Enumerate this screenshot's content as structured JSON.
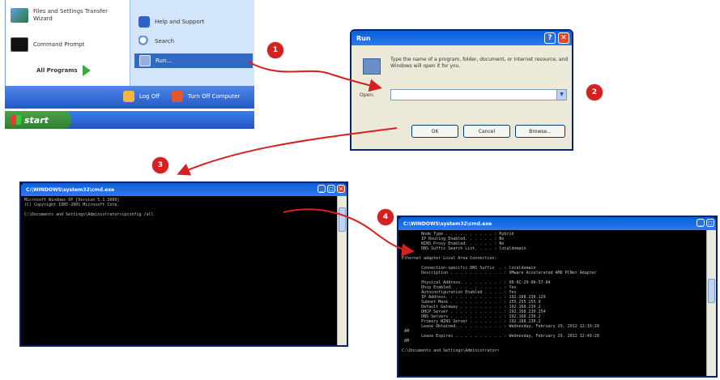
{
  "start_menu": {
    "items_left": [
      {
        "label": "Files and Settings Transfer Wizard",
        "icon": "transfer-wizard-icon"
      },
      {
        "label": "Command Prompt",
        "icon": "command-prompt-icon"
      }
    ],
    "all_programs": "All Programs",
    "items_right": [
      {
        "label": "Help and Support",
        "icon": "help-icon"
      },
      {
        "label": "Search",
        "icon": "search-icon"
      },
      {
        "label": "Run...",
        "icon": "run-icon"
      }
    ],
    "log_off": "Log Off",
    "turn_off": "Turn Off Computer",
    "start_button": "start"
  },
  "run_dialog": {
    "title": "Run",
    "description": "Type the name of a program, folder, document, or Internet resource, and Windows will open it for you.",
    "open_label": "Open:",
    "open_value": "",
    "buttons": {
      "ok": "OK",
      "cancel": "Cancel",
      "browse": "Browse..."
    }
  },
  "console1": {
    "title": "C:\\WINDOWS\\system32\\cmd.exe",
    "lines": [
      "Microsoft Windows XP [Version 5.1.2600]",
      "(C) Copyright 1985-2001 Microsoft Corp.",
      "",
      "C:\\Documents and Settings\\Administrator>ipconfig /all"
    ]
  },
  "console2": {
    "title": "C:\\WINDOWS\\system32\\cmd.exe",
    "lines": [
      "        Node Type . . . . . . . . . . : Hybrid",
      "        IP Routing Enabled. . . . . . : No",
      "        WINS Proxy Enabled. . . . . . : No",
      "        DNS Suffix Search List. . . . : localdomain",
      "",
      "Ethernet adapter Local Area Connection:",
      "",
      "        Connection-specific DNS Suffix  . : localdomain",
      "        Description . . . . . . . . . . . : VMware Accelerated AMD PCNet Adapter",
      "",
      "        Physical Address. . . . . . . . . : 00-0C-29-0A-57-84",
      "        Dhcp Enabled. . . . . . . . . . . : Yes",
      "        Autoconfiguration Enabled . . . . : Yes",
      "        IP Address. . . . . . . . . . . . : 192.168.230.129",
      "        Subnet Mask . . . . . . . . . . . : 255.255.255.0",
      "        Default Gateway . . . . . . . . . : 192.168.230.2",
      "        DHCP Server . . . . . . . . . . . : 192.168.230.254",
      "        DNS Servers . . . . . . . . . . . : 192.168.230.2",
      "        Primary WINS Server . . . . . . . : 192.168.230.2",
      "        Lease Obtained. . . . . . . . . . : Wednesday, February 29, 2012 12:19:28",
      " AM",
      "        Lease Expires . . . . . . . . . . : Wednesday, February 29, 2012 12:49:28",
      " AM",
      "",
      "C:\\Documents and Settings\\Administrator>"
    ]
  },
  "steps": [
    "1",
    "2",
    "3",
    "4"
  ],
  "colors": {
    "badge": "#d72020",
    "arrow": "#d72020",
    "xp_blue": "#2459c9",
    "start_green": "#3f973f"
  }
}
